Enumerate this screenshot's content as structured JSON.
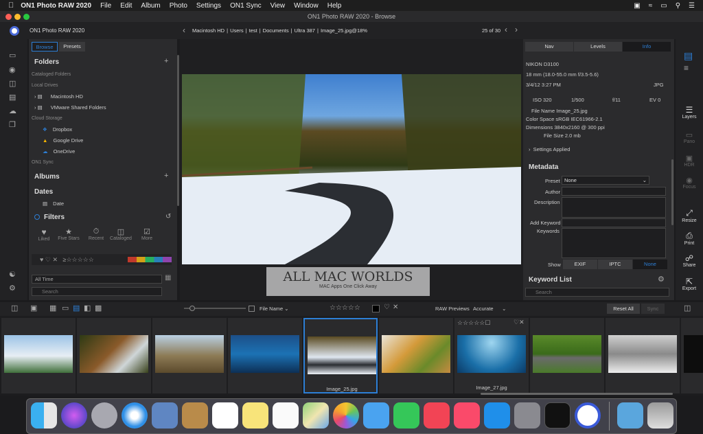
{
  "menubar": {
    "app_name": "ON1 Photo RAW 2020",
    "items": [
      "File",
      "Edit",
      "Album",
      "Photo",
      "Settings",
      "ON1 Sync",
      "View",
      "Window",
      "Help"
    ]
  },
  "window": {
    "title": "ON1 Photo RAW 2020 - Browse"
  },
  "toolbar": {
    "app_label": "ON1 Photo RAW 2020",
    "breadcrumb": [
      "Macintosh HD",
      "Users",
      "test",
      "Documents",
      "Ultra 387",
      "Image_25.jpg@18%"
    ],
    "page_counter": "25 of 30"
  },
  "left_panel": {
    "tabs": [
      "Browse",
      "Presets"
    ],
    "folders_title": "Folders",
    "cataloged_folders": "Cataloged Folders",
    "local_drives": "Local Drives",
    "drives": [
      "Macintosh HD",
      "VMware Shared Folders"
    ],
    "cloud_storage": "Cloud Storage",
    "clouds": [
      "Dropbox",
      "Google Drive",
      "OneDrive"
    ],
    "on1_sync": "ON1 Sync",
    "albums": "Albums",
    "dates": "Dates",
    "date_item": "Date",
    "filters": "Filters",
    "filter_buttons": [
      "Liked",
      "Five Stars",
      "Recent",
      "Cataloged",
      "More"
    ],
    "time_select": "All Time",
    "search_placeholder": "Search"
  },
  "right_panel": {
    "tabs": [
      "Nav",
      "Levels",
      "Info"
    ],
    "camera": "NIKON D3100",
    "lens": "18 mm (18.0-55.0 mm f/3.5-5.6)",
    "datetime": "3/4/12 3:27 PM",
    "format": "JPG",
    "exposure": [
      "ISO 320",
      "1/500",
      "f/11",
      "EV 0"
    ],
    "file_name": "File Name Image_25.jpg",
    "color_space": "Color Space sRGB IEC61966-2.1",
    "dimensions": "Dimensions 3840x2160 @ 300 ppi",
    "file_size": "File Size 2.0 mb",
    "settings_applied": "Settings Applied",
    "metadata_title": "Metadata",
    "preset_label": "Preset",
    "preset_value": "None",
    "author_label": "Author",
    "description_label": "Description",
    "add_keyword_label": "Add Keyword",
    "keywords_label": "Keywords",
    "show_label": "Show",
    "show_tabs": [
      "EXIF",
      "IPTC",
      "None"
    ],
    "keyword_list": "Keyword List",
    "search_placeholder": "Search"
  },
  "right_icons": [
    "Layers",
    "Pano",
    "HDR",
    "Focus",
    "Resize",
    "Print",
    "Share",
    "Export"
  ],
  "watermark": {
    "title": "ALL MAC WORLDS",
    "subtitle": "MAC Apps One Click Away"
  },
  "bottom_bar": {
    "sort_label": "File Name",
    "raw_previews_label": "RAW Previews",
    "raw_previews_value": "Accurate",
    "reset_all": "Reset All",
    "sync": "Sync"
  },
  "filmstrip": {
    "captions": [
      "",
      "",
      "",
      "",
      "Image_25.jpg",
      "",
      "Image_27.jpg",
      "",
      ""
    ]
  },
  "colors": {
    "accent": "#2d7fd6",
    "panel": "#2b2b2d",
    "background": "#1b1b1d"
  }
}
